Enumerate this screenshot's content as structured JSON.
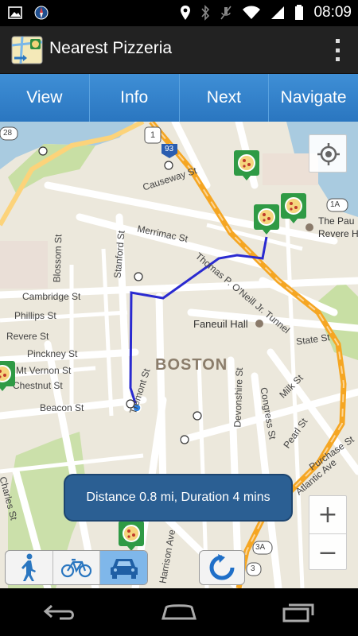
{
  "status_bar": {
    "time": "08:09",
    "left_icons": [
      "image-icon",
      "compass-icon"
    ],
    "right_icons": [
      "location-icon",
      "bluetooth-icon",
      "mute-icon",
      "wifi-icon",
      "signal-icon",
      "battery-icon"
    ]
  },
  "app": {
    "title": "Nearest Pizzeria",
    "icon": "map-pizza-icon"
  },
  "tabs": [
    {
      "label": "View"
    },
    {
      "label": "Info"
    },
    {
      "label": "Next"
    },
    {
      "label": "Navigate"
    }
  ],
  "map": {
    "city_label": "BOSTON",
    "places": {
      "faneuil_hall": "Faneuil Hall",
      "paul_revere_line1": "The Pau",
      "paul_revere_line2": "Revere H"
    },
    "streets": {
      "causeway": "Causeway St",
      "merrimac": "Merrimac St",
      "stanford": "Stanford St",
      "blossom": "Blossom St",
      "cambridge": "Cambridge St",
      "phillips": "Phillips St",
      "revere": "Revere St",
      "pinckney": "Pinckney St",
      "mt_vernon": "Mt Vernon St",
      "chestnut": "Chestnut St",
      "beacon": "Beacon St",
      "tremont": "Tremont St",
      "charles": "Charles St",
      "devonshire": "Devonshire St",
      "congress": "Congress St",
      "state": "State St",
      "milk": "Milk St",
      "pearl": "Pearl St",
      "purchase": "Purchase St",
      "atlantic": "Atlantic Ave",
      "harrison": "Harrison Ave",
      "tunnel": "Thomas P. O'Neill Jr. Tunnel"
    },
    "shields": {
      "r28": "28",
      "r1": "1",
      "i93": "93",
      "r1a": "1A",
      "r3a": "3A",
      "r3": "3"
    },
    "colors": {
      "route": "#2a2ad0",
      "highway": "#f5a623",
      "water": "#a9cbe0",
      "park": "#c8dfa4"
    }
  },
  "info_toast": "Distance 0.8 mi, Duration 4 mins",
  "zoom": {
    "in": "+",
    "out": "−"
  },
  "travel_modes": [
    {
      "name": "walk",
      "icon": "walk-icon",
      "active": false
    },
    {
      "name": "bike",
      "icon": "bike-icon",
      "active": false
    },
    {
      "name": "car",
      "icon": "car-icon",
      "active": true
    }
  ],
  "system_nav": [
    "back-icon",
    "home-icon",
    "recents-icon"
  ]
}
